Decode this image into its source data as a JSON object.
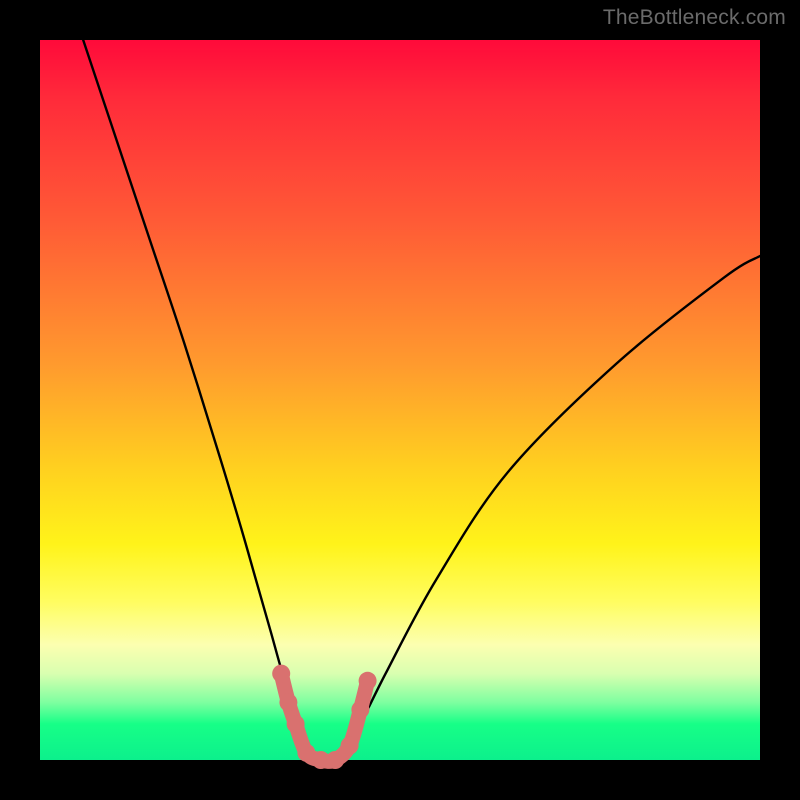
{
  "watermark": "TheBottleneck.com",
  "colors": {
    "background": "#000000",
    "curve": "#000000",
    "marker": "#d9716f",
    "marker_scatter": "#d9716f"
  },
  "chart_data": {
    "type": "line",
    "title": "",
    "xlabel": "",
    "ylabel": "",
    "xlim": [
      0,
      100
    ],
    "ylim": [
      0,
      100
    ],
    "grid": false,
    "legend": false,
    "series": [
      {
        "name": "bottleneck-curve",
        "x": [
          6,
          10,
          15,
          20,
          25,
          28,
          30,
          32,
          34,
          36,
          37,
          38,
          39,
          40,
          41,
          42,
          44,
          48,
          55,
          65,
          80,
          95,
          100
        ],
        "y": [
          100,
          88,
          73,
          58,
          42,
          32,
          25,
          18,
          11,
          6,
          3,
          1,
          0,
          0,
          0,
          1,
          4,
          12,
          25,
          40,
          55,
          67,
          70
        ]
      }
    ],
    "markers": {
      "name": "highlight-points",
      "points": [
        {
          "x": 33.5,
          "y": 12
        },
        {
          "x": 34.5,
          "y": 8
        },
        {
          "x": 35.5,
          "y": 5
        },
        {
          "x": 37.0,
          "y": 1
        },
        {
          "x": 39.0,
          "y": 0
        },
        {
          "x": 41.0,
          "y": 0
        },
        {
          "x": 43.0,
          "y": 2
        },
        {
          "x": 44.5,
          "y": 7
        },
        {
          "x": 45.5,
          "y": 11
        }
      ]
    }
  }
}
